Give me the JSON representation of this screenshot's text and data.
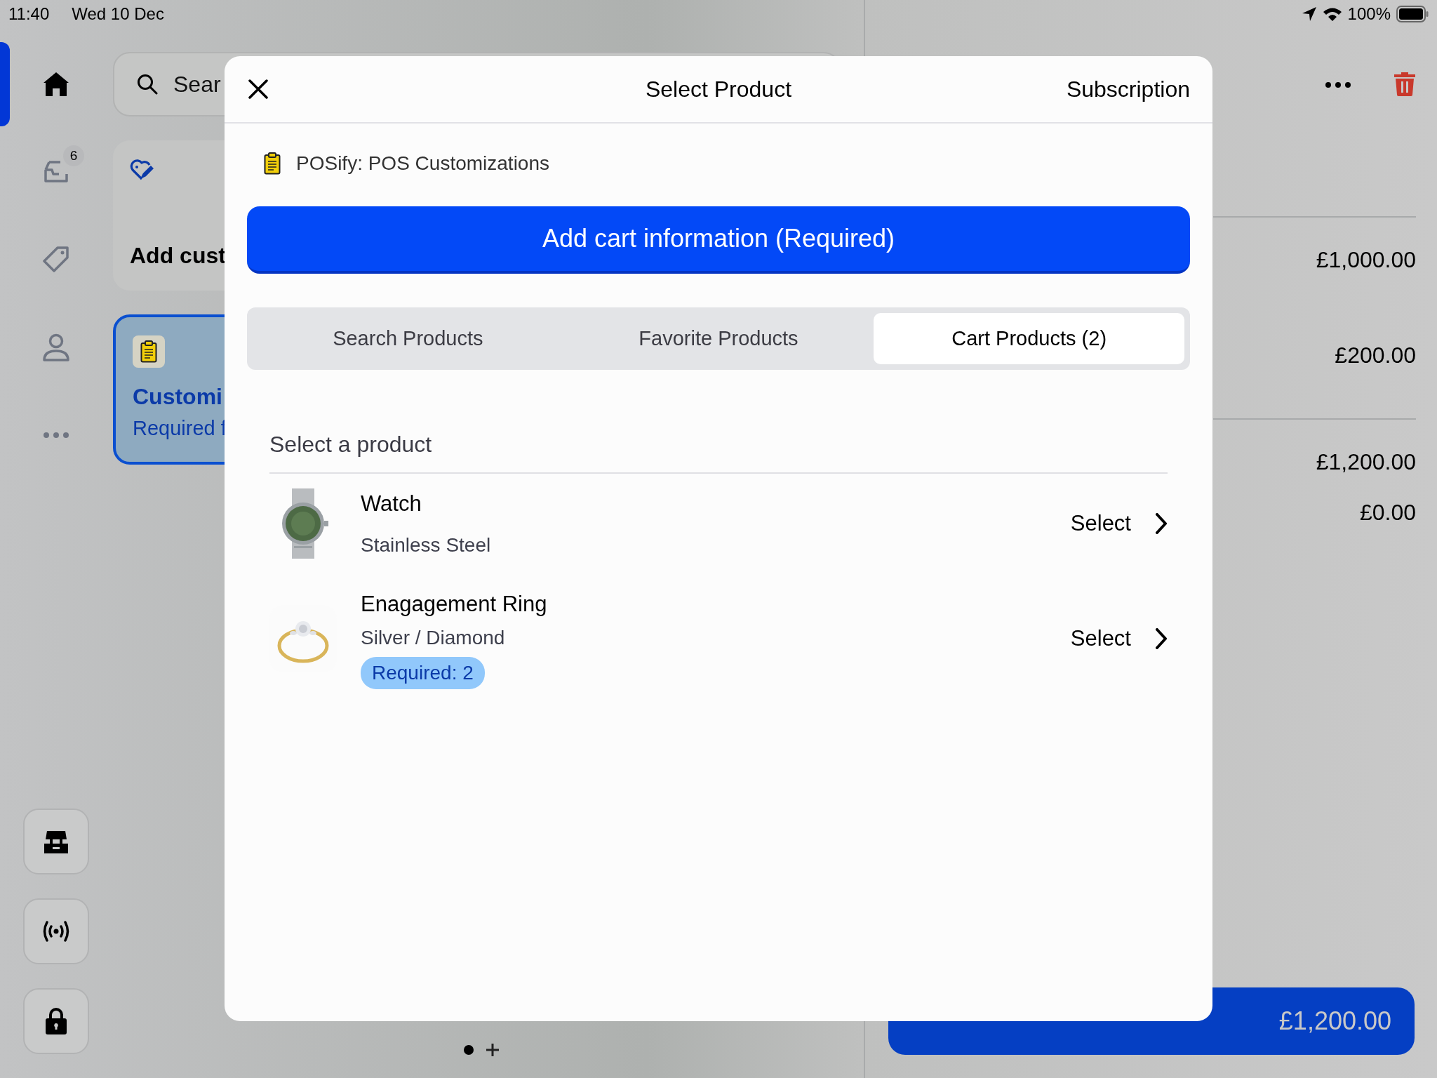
{
  "status_bar": {
    "time": "11:40",
    "date": "Wed 10 Dec",
    "battery": "100%"
  },
  "sidebar": {
    "items": [
      {
        "kind": "home",
        "selected": true
      },
      {
        "kind": "inbox",
        "selected": false,
        "badge": "6"
      },
      {
        "kind": "tag",
        "selected": false
      },
      {
        "kind": "person",
        "selected": false
      },
      {
        "kind": "more",
        "selected": false
      }
    ],
    "bottom_buttons": [
      {
        "kind": "store"
      },
      {
        "kind": "broadcast"
      },
      {
        "kind": "lock"
      }
    ]
  },
  "search": {
    "placeholder": "Sear"
  },
  "cards": [
    {
      "kind": "customer",
      "title": "Add cust",
      "selected": false
    },
    {
      "kind": "customization",
      "title": "Customi",
      "subtitle": "Required f",
      "selected": true
    }
  ],
  "summary": {
    "amounts": [
      "£1,000.00",
      "£200.00",
      "£1,200.00",
      "£0.00"
    ],
    "checkout": {
      "amount": "£1,200.00"
    }
  },
  "modal": {
    "title": "Select Product",
    "action": "Subscription",
    "app": "POSify: POS Customizations",
    "primary_button": "Add cart information (Required)",
    "tabs": [
      {
        "label": "Search Products",
        "selected": false
      },
      {
        "label": "Favorite Products",
        "selected": false
      },
      {
        "label": "Cart Products (2)",
        "selected": true
      }
    ],
    "section_title": "Select a product",
    "products": [
      {
        "name": "Watch",
        "variant": "Stainless Steel",
        "action": "Select"
      },
      {
        "name": "Enagagement Ring",
        "variant": "Silver / Diamond",
        "required": "Required: 2",
        "action": "Select"
      }
    ]
  }
}
